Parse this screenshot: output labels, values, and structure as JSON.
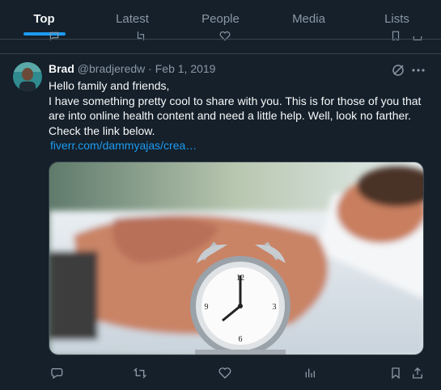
{
  "tabs": [
    {
      "label": "Top",
      "active": true
    },
    {
      "label": "Latest",
      "active": false
    },
    {
      "label": "People",
      "active": false
    },
    {
      "label": "Media",
      "active": false
    },
    {
      "label": "Lists",
      "active": false
    }
  ],
  "tweet": {
    "author_name": "Brad",
    "handle": "@bradjeredw",
    "separator": " · ",
    "date": "Feb 1, 2019",
    "lines": [
      "Hello family and friends,",
      "I have something pretty cool to share with you. This is for those of you that",
      "are into online health content and need a little help. Well, look no farther.",
      "Check the link below."
    ],
    "link": "fiverr.com/dammyajas/crea…"
  },
  "colors": {
    "background": "#15202b",
    "accent": "#1d9bf0",
    "muted": "#8b98a5",
    "border": "#38444d"
  },
  "icons": {
    "reply": "reply-icon",
    "retweet": "retweet-icon",
    "like": "like-icon",
    "views": "views-icon",
    "bookmark": "bookmark-icon",
    "share": "share-icon",
    "grok": "grok-icon",
    "more": "more-icon"
  }
}
